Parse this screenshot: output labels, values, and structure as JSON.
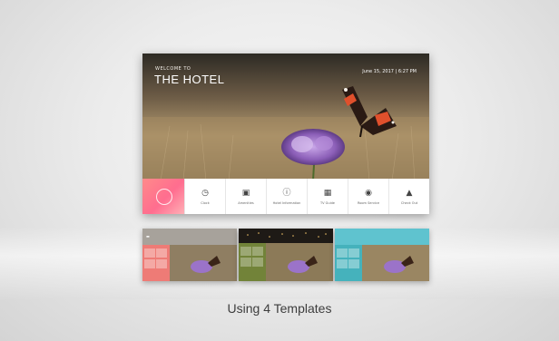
{
  "screen": {
    "welcome": "WELCOME TO",
    "title": "THE HOTEL",
    "datetime": "June 15, 2017  |  6:27 PM"
  },
  "menu": {
    "items": [
      {
        "label": "Clock",
        "icon": "clock-icon"
      },
      {
        "label": "Amenities",
        "icon": "camera-icon"
      },
      {
        "label": "Hotel Information",
        "icon": "info-icon"
      },
      {
        "label": "TV Guide",
        "icon": "tv-icon"
      },
      {
        "label": "Room Service",
        "icon": "chat-icon"
      },
      {
        "label": "Check Out",
        "icon": "tray-icon"
      }
    ],
    "accent_color": "#ff6d8f"
  },
  "templates": [
    {
      "name": "template-1",
      "accent_color": "#ff7a7a"
    },
    {
      "name": "template-2",
      "accent_color": "#8a9e3c"
    },
    {
      "name": "template-3",
      "accent_color": "#3cb7c6"
    }
  ],
  "caption": "Using 4 Templates"
}
